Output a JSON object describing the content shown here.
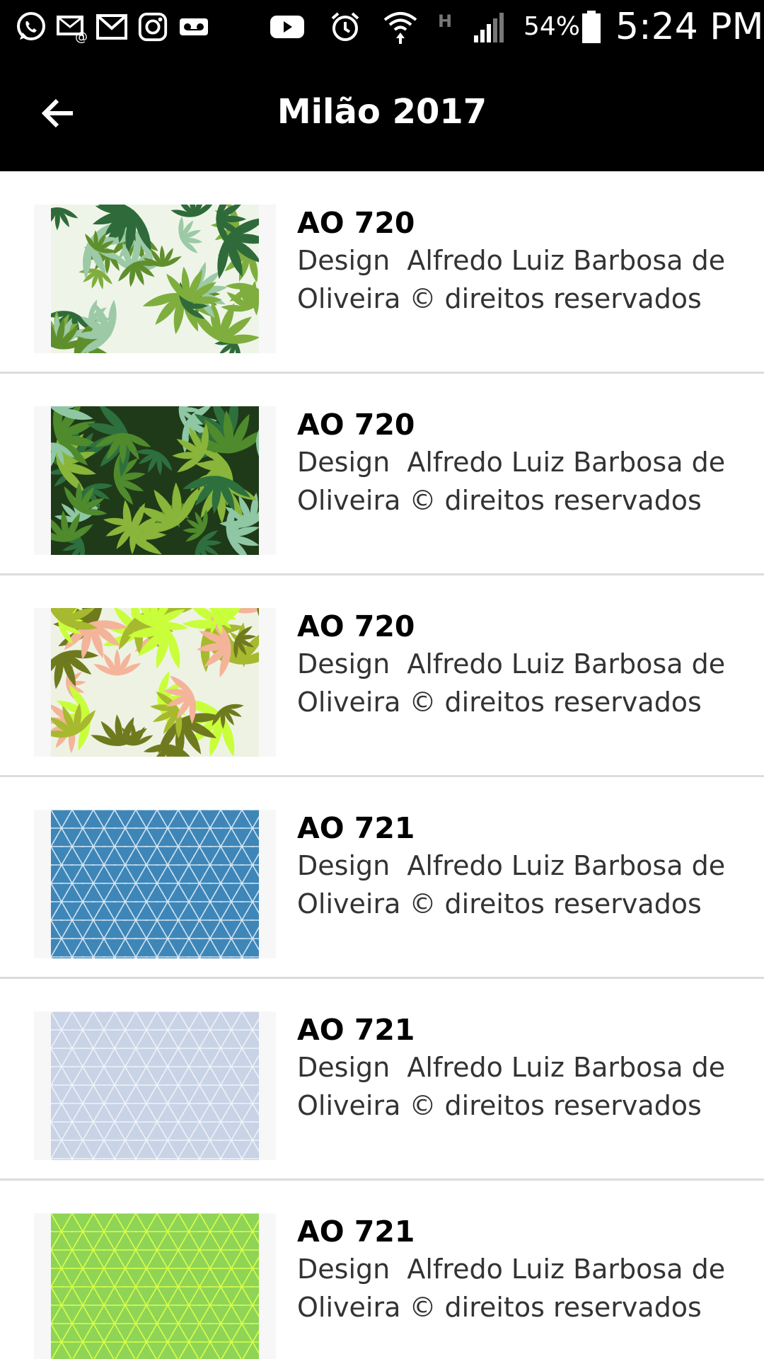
{
  "status_bar": {
    "icons": [
      "whatsapp-icon",
      "voicemail-mail-icon",
      "gmail-icon",
      "instagram-icon",
      "voicemail-icon",
      "youtube-icon",
      "alarm-icon",
      "wifi-icon",
      "network-h-icon",
      "signal-icon",
      "battery-icon"
    ],
    "battery_percent": "54%",
    "time": "5:24 PM"
  },
  "header": {
    "title": "Milão 2017",
    "back_icon": "arrow-left-icon"
  },
  "items": [
    {
      "title": "AO 720",
      "description": "Design  Alfredo Luiz Barbosa de Oliveira © direitos reservados",
      "pattern": "leaves",
      "colors": {
        "bg": "#eef5e8",
        "c1": "#2f6b3a",
        "c2": "#7fae3e",
        "c3": "#9cc9a6",
        "c4": "#5f8f2c"
      }
    },
    {
      "title": "AO 720",
      "description": "Design  Alfredo Luiz Barbosa de Oliveira © direitos reservados",
      "pattern": "leaves",
      "colors": {
        "bg": "#1f3a18",
        "c1": "#2e6f3e",
        "c2": "#89b53a",
        "c3": "#8fc7a4",
        "c4": "#4f8a2c"
      }
    },
    {
      "title": "AO 720",
      "description": "Design  Alfredo Luiz Barbosa de Oliveira © direitos reservados",
      "pattern": "leaves",
      "colors": {
        "bg": "#eef2e3",
        "c1": "#6f7a1e",
        "c2": "#c8ff3a",
        "c3": "#f4b49a",
        "c4": "#a7b92e"
      }
    },
    {
      "title": "AO 721",
      "description": "Design  Alfredo Luiz Barbosa de Oliveira © direitos reservados",
      "pattern": "stars",
      "colors": {
        "bg": "#3f86b8",
        "line": "#cfe3f1"
      }
    },
    {
      "title": "AO 721",
      "description": "Design  Alfredo Luiz Barbosa de Oliveira © direitos reservados",
      "pattern": "stars",
      "colors": {
        "bg": "#c9d3e6",
        "line": "#edf1f8"
      }
    },
    {
      "title": "AO 721",
      "description": "Design  Alfredo Luiz Barbosa de Oliveira © direitos reservados",
      "pattern": "stars",
      "colors": {
        "bg": "#8fd456",
        "line": "#d8ff4a"
      }
    }
  ]
}
